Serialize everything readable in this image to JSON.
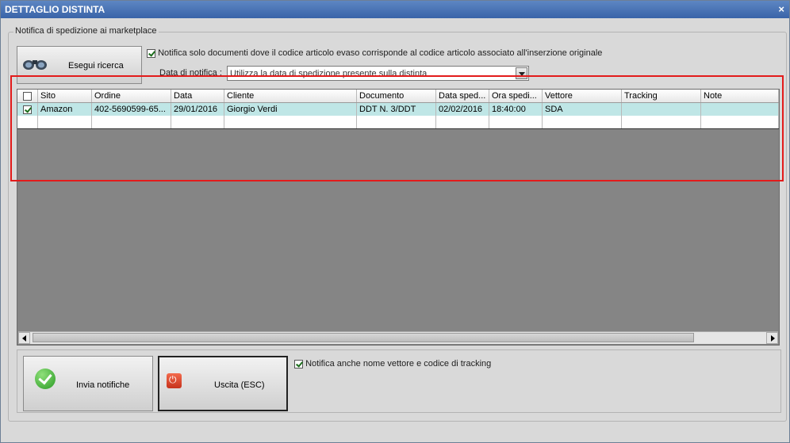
{
  "window": {
    "title": "DETTAGLIO DISTINTA",
    "close_glyph": "×"
  },
  "group": {
    "label": "Notifica di spedizione ai marketplace"
  },
  "search_button": {
    "label": "Esegui ricerca",
    "icon": "binoculars-icon"
  },
  "option_match_code": {
    "checked": true,
    "label": "Notifica solo documenti dove il codice articolo evaso corrisponde al codice articolo associato all'inserzione originale"
  },
  "notification_date": {
    "label": "Data di notifica :",
    "value": "Utilizza la data di spedizione presente sulla distinta"
  },
  "grid": {
    "columns": [
      "",
      "Sito",
      "Ordine",
      "Data",
      "Cliente",
      "Documento",
      "Data sped...",
      "Ora spedi...",
      "Vettore",
      "Tracking",
      "Note"
    ],
    "rows": [
      {
        "checked": true,
        "cells": [
          "Amazon",
          "402-5690599-65...",
          "29/01/2016",
          "Giorgio Verdi",
          "DDT N. 3/DDT",
          "02/02/2016",
          "18:40:00",
          "SDA",
          "",
          ""
        ]
      }
    ]
  },
  "send_button": {
    "label": "Invia notifiche",
    "icon": "check-circle-icon"
  },
  "exit_button": {
    "label": "Uscita (ESC)",
    "icon": "power-icon"
  },
  "option_tracking": {
    "checked": true,
    "label": "Notifica anche nome vettore e codice di tracking"
  },
  "colors": {
    "title_bar": "#4a74b6",
    "selected_row": "#bfe6e6",
    "highlight": "#e31b1b",
    "grid_bg": "#858585"
  }
}
